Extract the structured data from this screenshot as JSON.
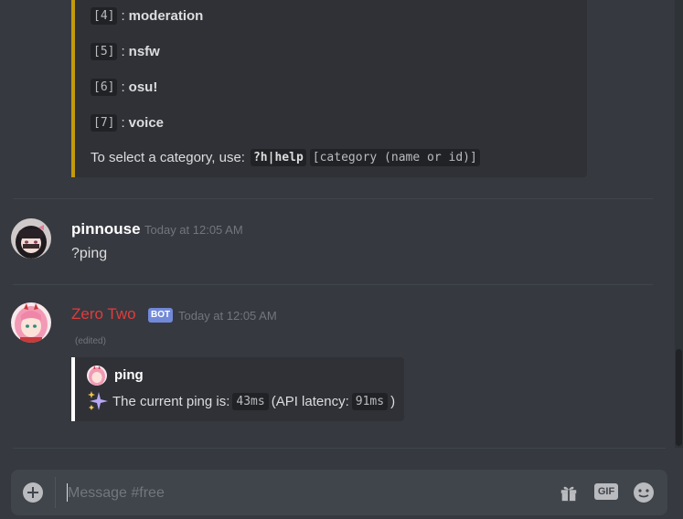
{
  "help_embed": {
    "categories": [
      {
        "id": "[4]",
        "name": "moderation"
      },
      {
        "id": "[5]",
        "name": "nsfw"
      },
      {
        "id": "[6]",
        "name": "osu!"
      },
      {
        "id": "[7]",
        "name": "voice"
      }
    ],
    "select_text": "To select a category, use:",
    "select_cmd": "?h|help",
    "select_arg": "[category (name or id)]",
    "accent_color": "#c49a0c"
  },
  "messages": [
    {
      "username": "pinnouse",
      "timestamp": "Today at 12:05 AM",
      "text": "?ping",
      "avatar": "avatar-dark-hair"
    },
    {
      "username": "Zero Two",
      "username_color": "#e03c3c",
      "bot_tag": "BOT",
      "timestamp": "Today at 12:05 AM",
      "edited": "(edited)",
      "avatar": "avatar-pink-hair",
      "embed": {
        "author": "ping",
        "sparkle": "sparkles-icon",
        "desc_prefix": "The current ping is:",
        "ping_value": "43ms",
        "api_prefix": "(API latency:",
        "api_value": "91ms",
        "api_suffix": ")",
        "accent_color": "#ffffff"
      }
    }
  ],
  "composer": {
    "placeholder": "Message #free",
    "gif_label": "GIF"
  },
  "scrollbar": {
    "position": 0.93
  }
}
